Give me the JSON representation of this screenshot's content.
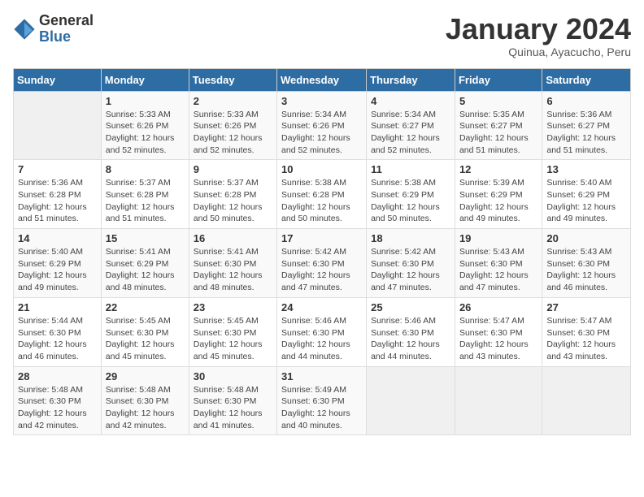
{
  "header": {
    "logo_general": "General",
    "logo_blue": "Blue",
    "month_title": "January 2024",
    "subtitle": "Quinua, Ayacucho, Peru"
  },
  "calendar": {
    "days_of_week": [
      "Sunday",
      "Monday",
      "Tuesday",
      "Wednesday",
      "Thursday",
      "Friday",
      "Saturday"
    ],
    "weeks": [
      [
        {
          "day": "",
          "info": ""
        },
        {
          "day": "1",
          "info": "Sunrise: 5:33 AM\nSunset: 6:26 PM\nDaylight: 12 hours\nand 52 minutes."
        },
        {
          "day": "2",
          "info": "Sunrise: 5:33 AM\nSunset: 6:26 PM\nDaylight: 12 hours\nand 52 minutes."
        },
        {
          "day": "3",
          "info": "Sunrise: 5:34 AM\nSunset: 6:26 PM\nDaylight: 12 hours\nand 52 minutes."
        },
        {
          "day": "4",
          "info": "Sunrise: 5:34 AM\nSunset: 6:27 PM\nDaylight: 12 hours\nand 52 minutes."
        },
        {
          "day": "5",
          "info": "Sunrise: 5:35 AM\nSunset: 6:27 PM\nDaylight: 12 hours\nand 51 minutes."
        },
        {
          "day": "6",
          "info": "Sunrise: 5:36 AM\nSunset: 6:27 PM\nDaylight: 12 hours\nand 51 minutes."
        }
      ],
      [
        {
          "day": "7",
          "info": "Sunrise: 5:36 AM\nSunset: 6:28 PM\nDaylight: 12 hours\nand 51 minutes."
        },
        {
          "day": "8",
          "info": "Sunrise: 5:37 AM\nSunset: 6:28 PM\nDaylight: 12 hours\nand 51 minutes."
        },
        {
          "day": "9",
          "info": "Sunrise: 5:37 AM\nSunset: 6:28 PM\nDaylight: 12 hours\nand 50 minutes."
        },
        {
          "day": "10",
          "info": "Sunrise: 5:38 AM\nSunset: 6:28 PM\nDaylight: 12 hours\nand 50 minutes."
        },
        {
          "day": "11",
          "info": "Sunrise: 5:38 AM\nSunset: 6:29 PM\nDaylight: 12 hours\nand 50 minutes."
        },
        {
          "day": "12",
          "info": "Sunrise: 5:39 AM\nSunset: 6:29 PM\nDaylight: 12 hours\nand 49 minutes."
        },
        {
          "day": "13",
          "info": "Sunrise: 5:40 AM\nSunset: 6:29 PM\nDaylight: 12 hours\nand 49 minutes."
        }
      ],
      [
        {
          "day": "14",
          "info": "Sunrise: 5:40 AM\nSunset: 6:29 PM\nDaylight: 12 hours\nand 49 minutes."
        },
        {
          "day": "15",
          "info": "Sunrise: 5:41 AM\nSunset: 6:29 PM\nDaylight: 12 hours\nand 48 minutes."
        },
        {
          "day": "16",
          "info": "Sunrise: 5:41 AM\nSunset: 6:30 PM\nDaylight: 12 hours\nand 48 minutes."
        },
        {
          "day": "17",
          "info": "Sunrise: 5:42 AM\nSunset: 6:30 PM\nDaylight: 12 hours\nand 47 minutes."
        },
        {
          "day": "18",
          "info": "Sunrise: 5:42 AM\nSunset: 6:30 PM\nDaylight: 12 hours\nand 47 minutes."
        },
        {
          "day": "19",
          "info": "Sunrise: 5:43 AM\nSunset: 6:30 PM\nDaylight: 12 hours\nand 47 minutes."
        },
        {
          "day": "20",
          "info": "Sunrise: 5:43 AM\nSunset: 6:30 PM\nDaylight: 12 hours\nand 46 minutes."
        }
      ],
      [
        {
          "day": "21",
          "info": "Sunrise: 5:44 AM\nSunset: 6:30 PM\nDaylight: 12 hours\nand 46 minutes."
        },
        {
          "day": "22",
          "info": "Sunrise: 5:45 AM\nSunset: 6:30 PM\nDaylight: 12 hours\nand 45 minutes."
        },
        {
          "day": "23",
          "info": "Sunrise: 5:45 AM\nSunset: 6:30 PM\nDaylight: 12 hours\nand 45 minutes."
        },
        {
          "day": "24",
          "info": "Sunrise: 5:46 AM\nSunset: 6:30 PM\nDaylight: 12 hours\nand 44 minutes."
        },
        {
          "day": "25",
          "info": "Sunrise: 5:46 AM\nSunset: 6:30 PM\nDaylight: 12 hours\nand 44 minutes."
        },
        {
          "day": "26",
          "info": "Sunrise: 5:47 AM\nSunset: 6:30 PM\nDaylight: 12 hours\nand 43 minutes."
        },
        {
          "day": "27",
          "info": "Sunrise: 5:47 AM\nSunset: 6:30 PM\nDaylight: 12 hours\nand 43 minutes."
        }
      ],
      [
        {
          "day": "28",
          "info": "Sunrise: 5:48 AM\nSunset: 6:30 PM\nDaylight: 12 hours\nand 42 minutes."
        },
        {
          "day": "29",
          "info": "Sunrise: 5:48 AM\nSunset: 6:30 PM\nDaylight: 12 hours\nand 42 minutes."
        },
        {
          "day": "30",
          "info": "Sunrise: 5:48 AM\nSunset: 6:30 PM\nDaylight: 12 hours\nand 41 minutes."
        },
        {
          "day": "31",
          "info": "Sunrise: 5:49 AM\nSunset: 6:30 PM\nDaylight: 12 hours\nand 40 minutes."
        },
        {
          "day": "",
          "info": ""
        },
        {
          "day": "",
          "info": ""
        },
        {
          "day": "",
          "info": ""
        }
      ]
    ]
  }
}
